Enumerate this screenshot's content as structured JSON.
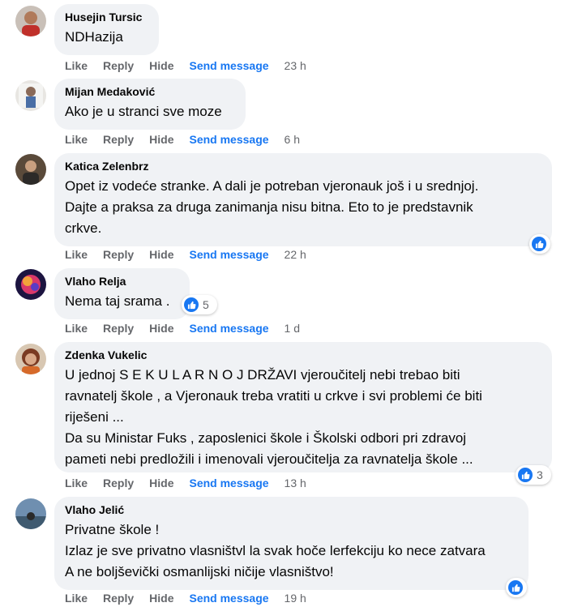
{
  "labels": {
    "like": "Like",
    "reply": "Reply",
    "hide": "Hide",
    "send": "Send message"
  },
  "colors": {
    "link": "#1877f2",
    "bubble": "#f0f2f5",
    "muted": "#65676b"
  },
  "comments": [
    {
      "author": "Husejin Tursic",
      "text": "NDHazija",
      "time": "23 h"
    },
    {
      "author": "Mijan Medaković",
      "text": "Ako je u stranci sve moze",
      "time": "6 h"
    },
    {
      "author": "Katica Zelenbrz",
      "text": "Opet iz vodeće stranke. A dali je potreban vjeronauk još i u srednjoj.\nDajte a praksa za druga zanimanja nisu bitna. Eto to je predstavnik\ncrkve.",
      "time": "22 h",
      "reaction_icon": "like-icon"
    },
    {
      "author": "Vlaho Relja",
      "text": "Nema taj srama .",
      "time": "1 d",
      "reaction_icon": "like-icon",
      "reaction_count": "5"
    },
    {
      "author": "Zdenka Vukelic",
      "text": "U jednoj S E K U L A R N O J DRŽAVI vjeroučitelj nebi trebao biti\nravnatelj škole , a Vjeronauk treba vratiti u crkve i svi problemi će biti\nriješeni ...\nDa su Ministar Fuks , zaposlenici škole i Školski odbori pri zdravoj\npameti nebi predložili i imenovali vjeroučitelja za ravnatelja škole ...",
      "time": "13 h",
      "reaction_icon": "like-icon",
      "reaction_count": "3"
    },
    {
      "author": "Vlaho Jelić",
      "text": "Privatne škole !\nIzlaz je sve privatno vlasništvl la svak hoče lerfekciju ko nece zatvara\nA ne boljševički osmanlijski ničije vlasništvo!",
      "time": "19 h",
      "reaction_icon": "like-icon"
    }
  ]
}
